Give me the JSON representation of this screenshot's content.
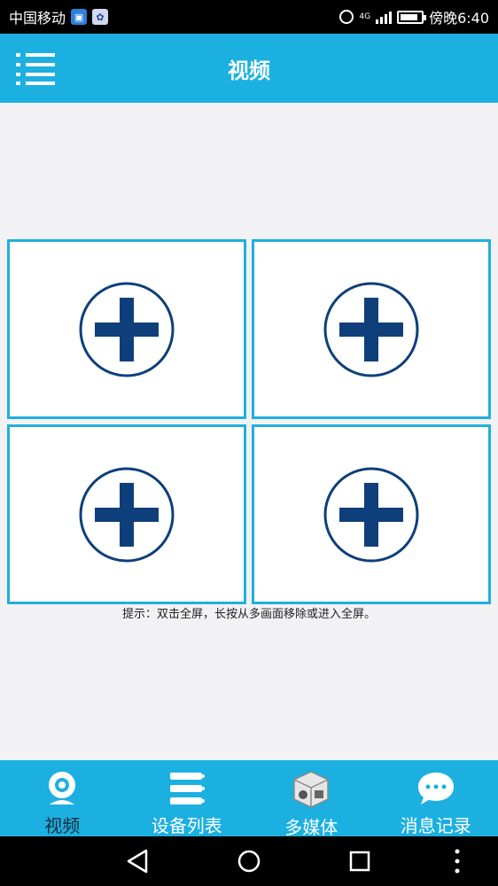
{
  "status_bar": {
    "carrier": "中国移动",
    "network": "4G",
    "time": "傍晚6:40",
    "battery_level": 0.85,
    "icons": [
      "app-notification-icon",
      "baidu-icon",
      "alarm-icon",
      "signal-icon",
      "battery-icon"
    ]
  },
  "header": {
    "title": "视频",
    "menu_icon": "list-menu-icon"
  },
  "video_grid": {
    "cells": [
      {
        "icon": "add-circle-icon"
      },
      {
        "icon": "add-circle-icon"
      },
      {
        "icon": "add-circle-icon"
      },
      {
        "icon": "add-circle-icon"
      }
    ]
  },
  "tip": "提示：双击全屏，长按从多画面移除或进入全屏。",
  "tabs": [
    {
      "label": "视频",
      "icon": "webcam-icon",
      "active": true
    },
    {
      "label": "设备列表",
      "icon": "device-list-icon",
      "active": false
    },
    {
      "label": "多媒体",
      "icon": "multimedia-box-icon",
      "active": false
    },
    {
      "label": "消息记录",
      "icon": "chat-bubble-icon",
      "active": false
    }
  ],
  "nav_bar": {
    "icons": [
      "back-triangle-icon",
      "home-circle-icon",
      "recents-square-icon",
      "more-dots-icon"
    ]
  },
  "colors": {
    "accent": "#1cb0e0",
    "cell_border": "#1fb0dc",
    "plus_circle": "#0e3f7a",
    "background": "#f2f2f4"
  }
}
